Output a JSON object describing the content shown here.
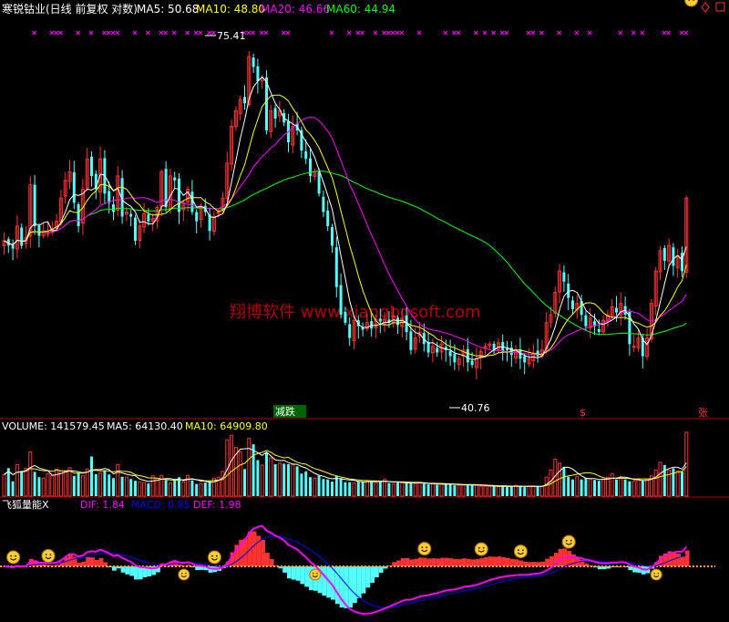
{
  "colors": {
    "background": "#000000",
    "up": "#ff3232",
    "down": "#54fcfc",
    "ma5": "#ffffff",
    "ma10": "#ffff00",
    "ma20": "#ff00ff",
    "ma60": "#00ff00",
    "volume_ma5": "#ffffff",
    "volume_ma10": "#ffff00",
    "separator": "#b00000",
    "watermark": "#b00000",
    "cross_marks": "#ff00ff",
    "macd_dif": "#ff00ff",
    "macd_dea": "#0000ff",
    "macd_label": "#0000ff",
    "macd_zero": "#ffa040",
    "signal_text": "#ff3232",
    "signal_badge_bg": "#006400",
    "smiley": "#ffcc33",
    "arrow_icon": "#ff9933"
  },
  "price_panel": {
    "title": "寒锐钴业(日线 前复权 对数)",
    "ma5_label": "MA5: 50.68",
    "ma10_label": "MA10: 48.80",
    "ma20_label": "MA20: 46.66",
    "ma60_label": "MA60: 44.94",
    "high_annotation": "75.41",
    "low_annotation": "40.76",
    "badge_text": "减跌",
    "signal_s": "$",
    "signal_zhang": "张",
    "watermark": "翔博软件 www.xiangbosoft.com"
  },
  "volume_panel": {
    "title": "VOLUME: 141579.45",
    "ma5_label": "MA5: 64130.40",
    "ma10_label": "MA10: 64909.80"
  },
  "macd_panel": {
    "title": "飞狐量能X",
    "dif_label": "DIF: 1.84",
    "macd_label": "MACD: 0.85",
    "dea_label": "DEF: 1.98"
  },
  "chart_data": [
    {
      "type": "candlestick",
      "title": "寒锐钴业(日线 前复权 对数)",
      "yscale": "log",
      "ylim": [
        37,
        80
      ],
      "series": [
        {
          "name": "MA5",
          "last": 50.68
        },
        {
          "name": "MA10",
          "last": 48.8
        },
        {
          "name": "MA20",
          "last": 46.66
        },
        {
          "name": "MA60",
          "last": 44.94
        }
      ],
      "annotations": [
        {
          "text": "75.41",
          "type": "max"
        },
        {
          "text": "40.76",
          "type": "min"
        }
      ],
      "close": [
        52.0,
        51.5,
        51.2,
        53.5,
        51.5,
        52.3,
        58.0,
        53.5,
        52.5,
        53.0,
        52.8,
        53.2,
        54.0,
        56.5,
        58.5,
        59.5,
        56.0,
        53.5,
        57.5,
        61.0,
        59.0,
        57.5,
        61.0,
        57.0,
        56.0,
        55.0,
        59.0,
        54.5,
        55.0,
        54.5,
        52.0,
        53.5,
        54.8,
        54.0,
        54.3,
        55.5,
        59.5,
        55.5,
        59.0,
        58.5,
        55.0,
        56.0,
        57.5,
        55.0,
        54.0,
        55.5,
        55.0,
        53.0,
        54.5,
        55.0,
        56.5,
        60.5,
        65.0,
        67.0,
        68.5,
        68.0,
        74.5,
        73.0,
        71.0,
        71.5,
        64.5,
        67.0,
        66.0,
        67.0,
        65.5,
        63.0,
        65.0,
        64.5,
        62.0,
        61.0,
        59.0,
        59.5,
        57.0,
        55.0,
        53.5,
        51.5,
        47.5,
        45.0,
        44.3,
        43.0,
        44.5,
        44.0,
        43.7,
        44.3,
        43.8,
        44.6,
        44.4,
        44.6,
        44.3,
        44.9,
        44.1,
        44.7,
        43.5,
        42.0,
        43.0,
        43.5,
        42.5,
        41.8,
        42.3,
        41.8,
        42.5,
        42.0,
        41.5,
        41.0,
        41.3,
        42.0,
        41.0,
        40.8,
        41.3,
        41.9,
        42.3,
        42.5,
        42.0,
        42.6,
        41.9,
        42.0,
        41.6,
        41.9,
        41.3,
        41.0,
        41.3,
        41.7,
        41.5,
        42.0,
        44.3,
        45.0,
        47.0,
        49.0,
        48.0,
        46.5,
        45.5,
        46.0,
        45.0,
        44.0,
        44.7,
        44.0,
        43.5,
        44.5,
        45.0,
        45.7,
        45.2,
        46.0,
        45.0,
        42.5,
        42.3,
        43.0,
        41.5,
        43.0,
        46.0,
        49.0,
        51.0,
        50.0,
        51.5,
        49.5,
        50.5,
        49.0,
        56.5
      ]
    },
    {
      "type": "bar",
      "title": "VOLUME: 141579.45",
      "series": [
        {
          "name": "MA5",
          "last": 64130.4
        },
        {
          "name": "MA10",
          "last": 64909.8
        }
      ],
      "values": [
        48000,
        62000,
        33000,
        70000,
        56000,
        62000,
        98000,
        54000,
        42000,
        40000,
        50000,
        46000,
        60000,
        56000,
        55000,
        63000,
        45000,
        52000,
        45000,
        60000,
        88000,
        49000,
        52000,
        57000,
        48000,
        40000,
        70000,
        43000,
        42000,
        38000,
        34000,
        32000,
        30000,
        28000,
        45000,
        39000,
        46000,
        36000,
        29000,
        35000,
        42000,
        32000,
        46000,
        35000,
        27000,
        28000,
        30000,
        33000,
        40000,
        42000,
        55000,
        125000,
        135000,
        108000,
        98000,
        60000,
        128000,
        115000,
        80000,
        69000,
        96000,
        85000,
        71000,
        73000,
        72000,
        71000,
        70000,
        66000,
        50000,
        55000,
        42000,
        40000,
        45000,
        38000,
        37000,
        32000,
        45000,
        40000,
        31000,
        31000,
        29000,
        33000,
        33000,
        34000,
        32000,
        30000,
        34000,
        37000,
        29000,
        27000,
        30000,
        30000,
        31000,
        30000,
        28000,
        29000,
        28000,
        26000,
        27000,
        25000,
        27000,
        26000,
        28000,
        24000,
        24000,
        24000,
        25000,
        26000,
        24000,
        22000,
        22000,
        21000,
        22000,
        21000,
        23000,
        20000,
        21000,
        24000,
        23000,
        20000,
        22000,
        22000,
        21000,
        22000,
        42000,
        58000,
        82000,
        73000,
        65000,
        43000,
        37000,
        43000,
        37000,
        40000,
        38000,
        36000,
        34000,
        38000,
        42000,
        50000,
        37000,
        43000,
        37000,
        33000,
        33000,
        36000,
        34000,
        38000,
        45000,
        58000,
        75000,
        69000,
        58000,
        62000,
        56000,
        54000,
        141579
      ]
    },
    {
      "type": "bar",
      "title": "飞狐量能X",
      "series": [
        {
          "name": "DIF",
          "last": 1.84
        },
        {
          "name": "MACD",
          "last": 0.85
        },
        {
          "name": "DEF",
          "last": 1.98
        }
      ],
      "zero_line": 0
    }
  ]
}
